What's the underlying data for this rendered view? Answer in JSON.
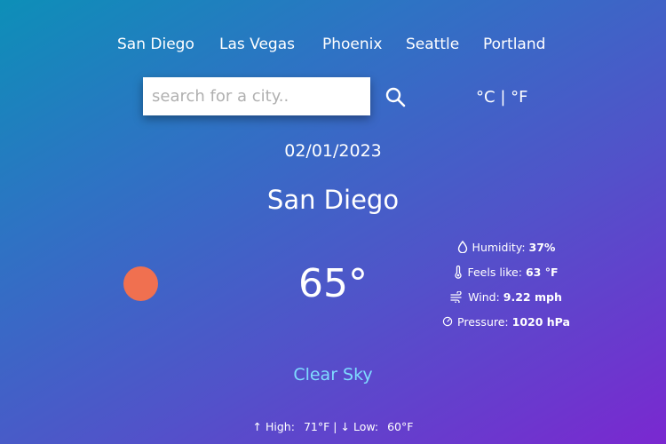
{
  "nav": {
    "cities": [
      "San Diego",
      "Las Vegas",
      "Phoenix",
      "Seattle",
      "Portland"
    ]
  },
  "search": {
    "placeholder": "search for a city.."
  },
  "units": {
    "celsius": "°C",
    "separator": "|",
    "fahrenheit": "°F"
  },
  "weather": {
    "date": "02/01/2023",
    "city": "San Diego",
    "temperature": "65°",
    "condition": "Clear Sky",
    "icon": "sun-icon",
    "icon_color": "#f07050"
  },
  "details": {
    "humidity_label": "Humidity:",
    "humidity_value": "37%",
    "feels_like_label": "Feels like:",
    "feels_like_value": "63 °F",
    "wind_label": "Wind:",
    "wind_value": "9.22 mph",
    "pressure_label": "Pressure:",
    "pressure_value": "1020 hPa"
  },
  "forecast": {
    "high_label": "High:",
    "high_value": "71°F",
    "separator": "|",
    "low_label": "Low:",
    "low_value": "60°F"
  },
  "colors": {
    "gradient_start": "#0d8fb8",
    "gradient_end": "#7a28d0",
    "condition_text": "#7fdcff"
  }
}
